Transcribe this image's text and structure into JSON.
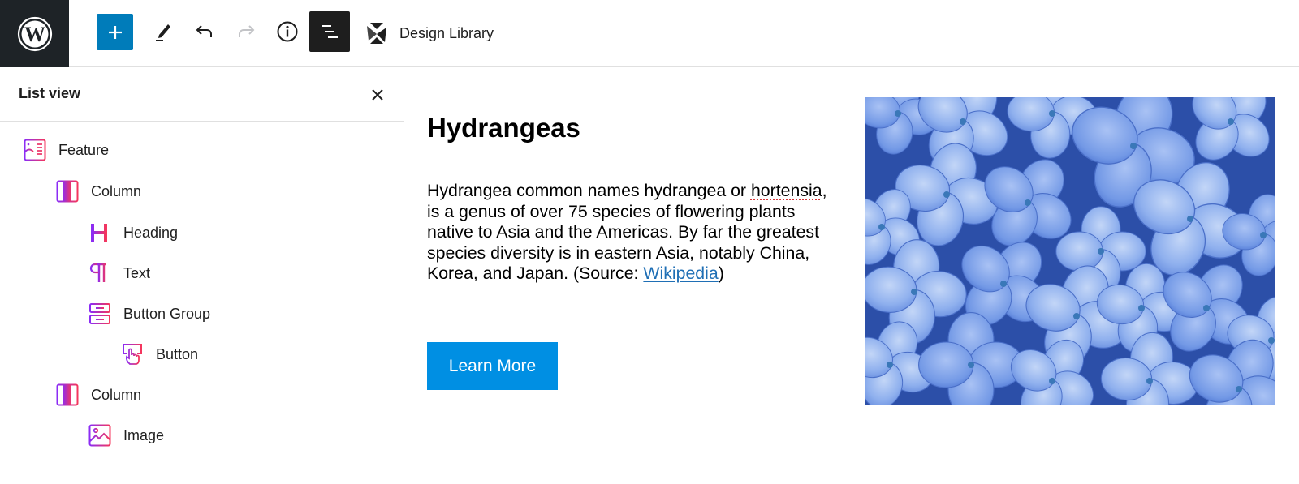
{
  "toolbar": {
    "logo": "wordpress-logo",
    "add_block": "plus-icon",
    "tools": "pencil-icon",
    "undo": "undo-icon",
    "redo": "redo-icon",
    "details": "info-icon",
    "list_view": "list-view-icon",
    "design_library_label": "Design Library",
    "colors": {
      "add_bg": "#007cba",
      "logo_bg": "#1e2327",
      "list_active_bg": "#1e1e1e",
      "redo_disabled": "#c3c4c7"
    }
  },
  "sidebar": {
    "title": "List view",
    "close": "close-icon",
    "items": [
      {
        "label": "Feature",
        "icon": "feature-icon",
        "level": 0
      },
      {
        "label": "Column",
        "icon": "column-icon",
        "level": 1
      },
      {
        "label": "Heading",
        "icon": "heading-icon",
        "level": 2
      },
      {
        "label": "Text",
        "icon": "paragraph-icon",
        "level": 2
      },
      {
        "label": "Button Group",
        "icon": "button-group-icon",
        "level": 2
      },
      {
        "label": "Button",
        "icon": "button-icon",
        "level": 3
      },
      {
        "label": "Column",
        "icon": "column-icon",
        "level": 1
      },
      {
        "label": "Image",
        "icon": "image-icon",
        "level": 2
      }
    ],
    "icon_gradient": [
      "#8b2cf5",
      "#f5365c"
    ]
  },
  "canvas": {
    "heading": "Hydrangeas",
    "paragraph": {
      "before": "Hydrangea common names hydrangea or ",
      "misspelled": "hortensia",
      "after": ", is a genus of over 75 species of flowering plants native to Asia and the Americas. By far the greatest species diversity is in eastern Asia, notably China, Korea, and Japan. (Source: ",
      "link_text": "Wikipedia",
      "end": ")"
    },
    "button_label": "Learn More",
    "button_color": "#008fe3",
    "image_alt": "Blue hydrangea flowers"
  }
}
